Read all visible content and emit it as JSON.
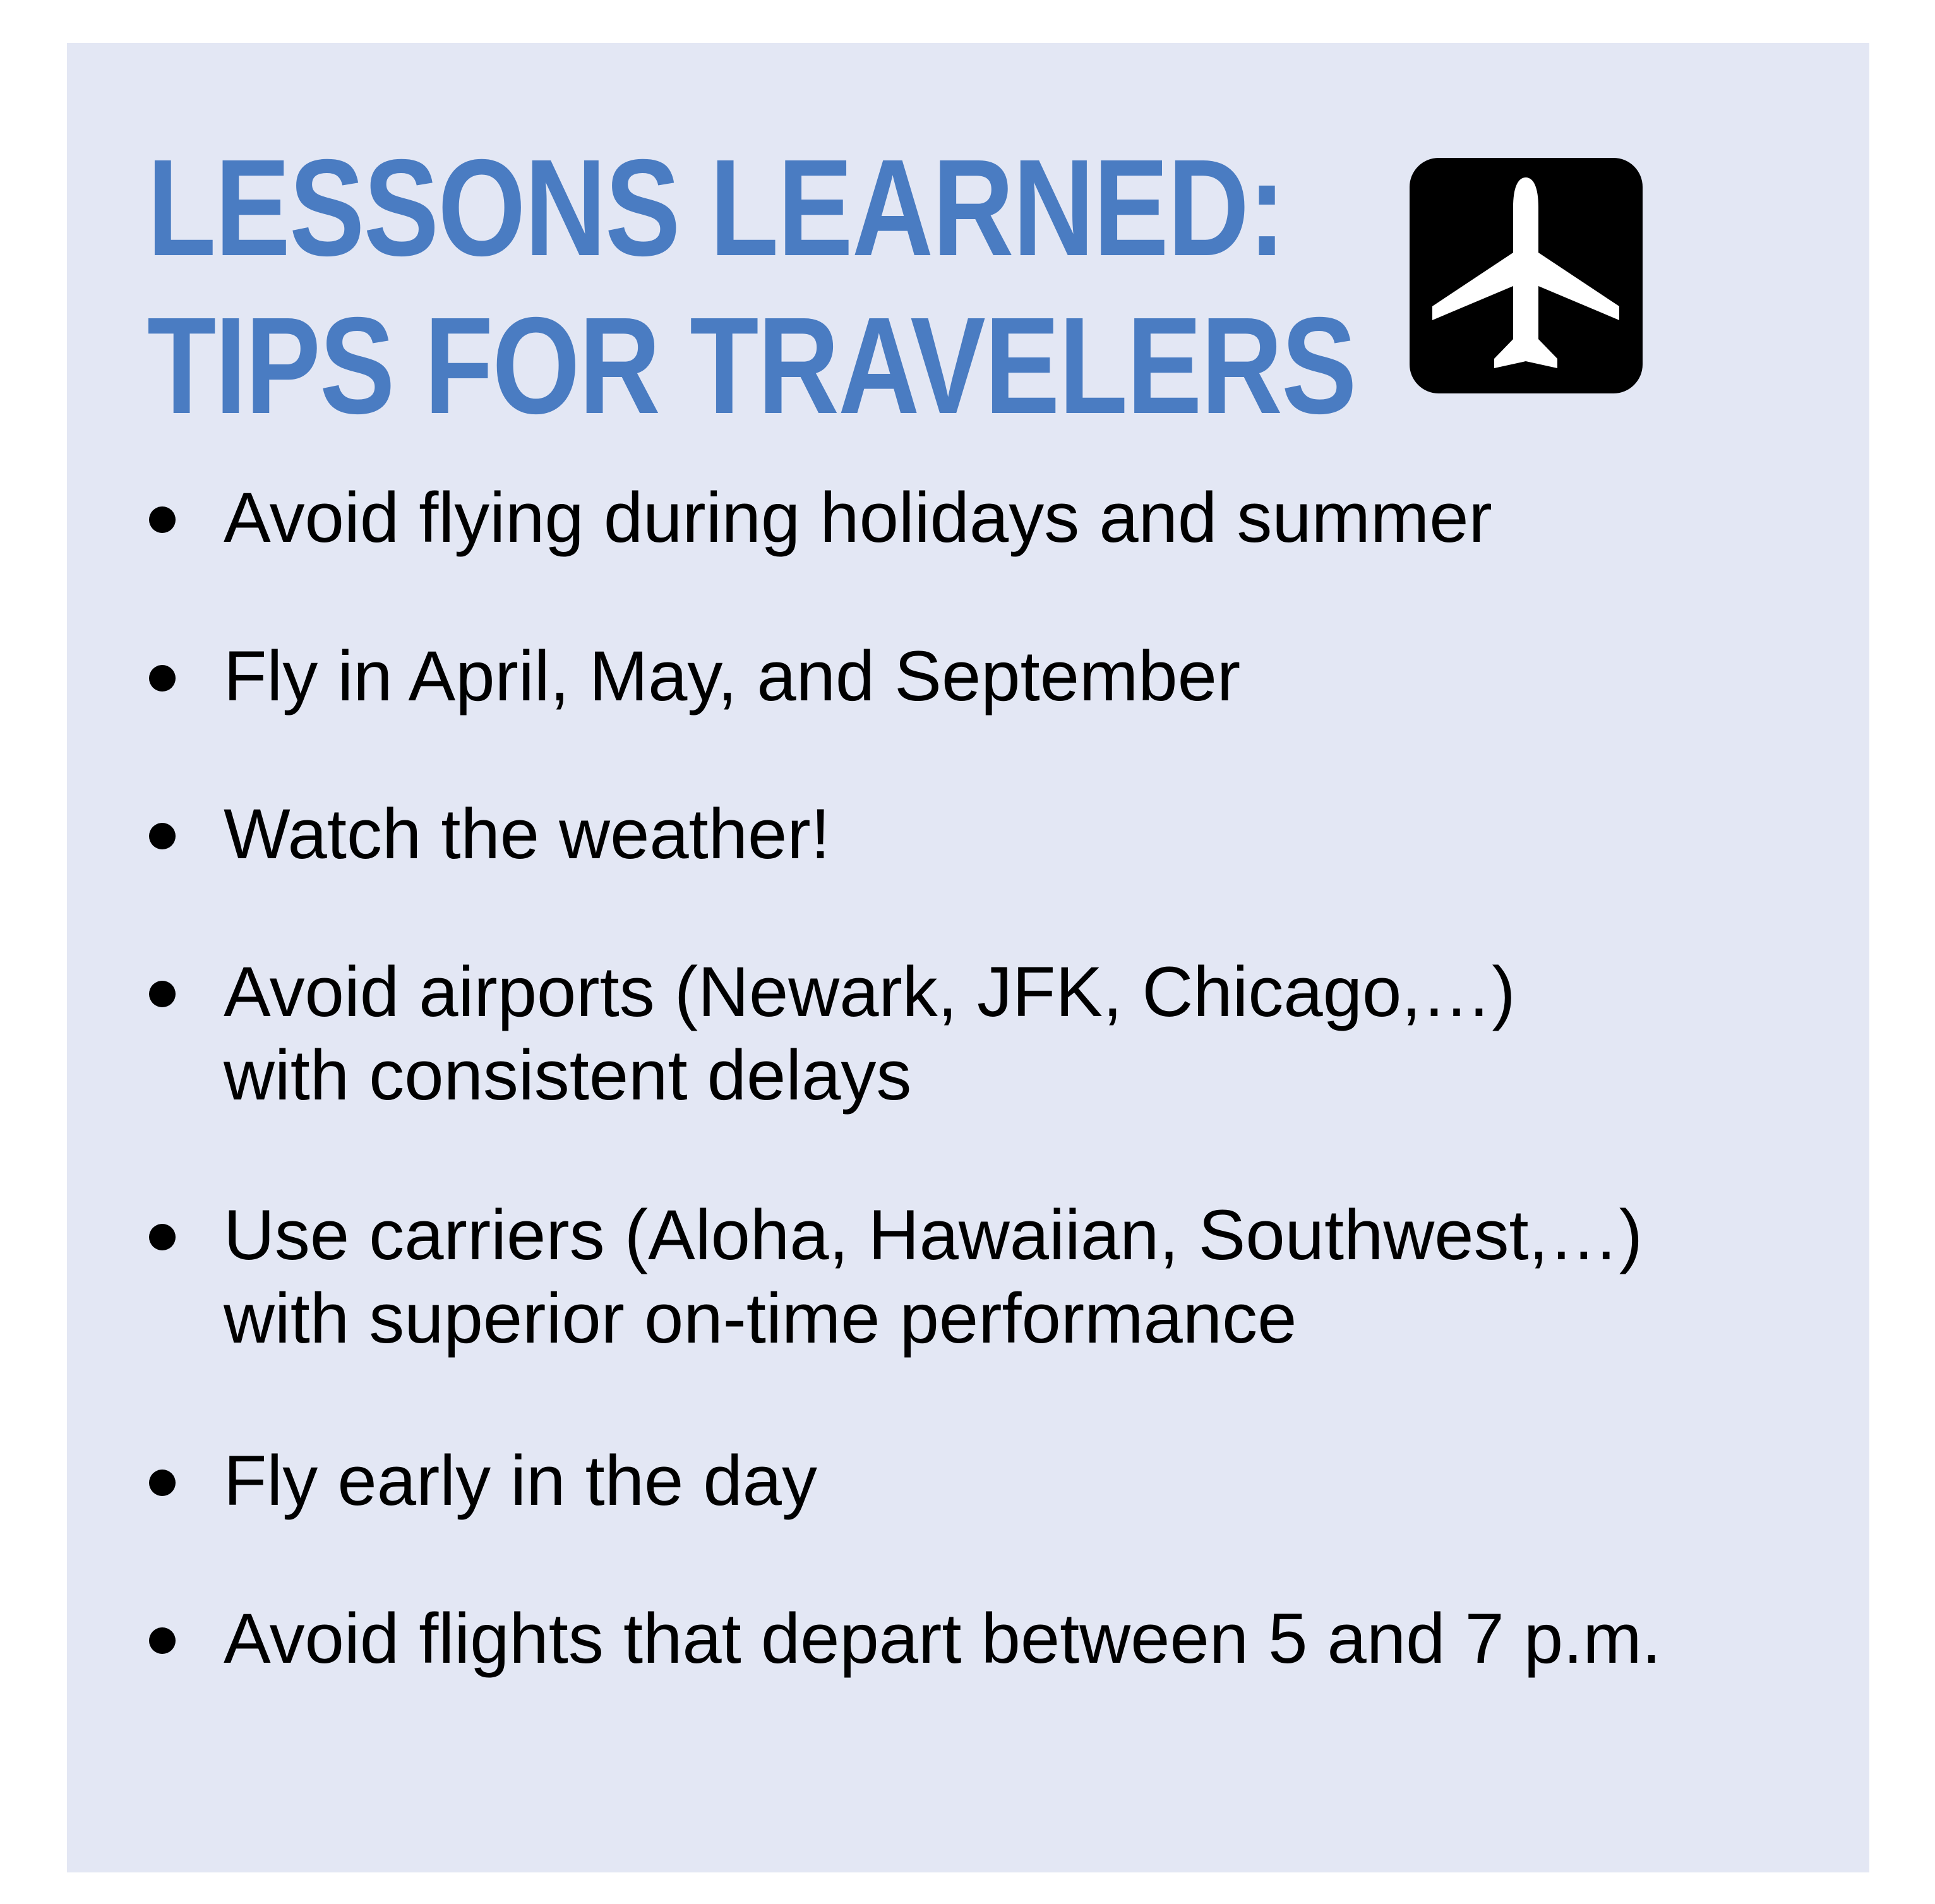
{
  "title": {
    "line1": "LESSONS LEARNED:",
    "line2": "TIPS FOR TRAVELERS"
  },
  "icon": "airplane-icon",
  "colors": {
    "panel_background": "#e3e7f4",
    "title": "#4a7cc2",
    "icon_badge": "#000000",
    "text": "#000000"
  },
  "tips": [
    {
      "line1": "Avoid flying during holidays and summer",
      "line2": ""
    },
    {
      "line1": "Fly in April, May, and September",
      "line2": ""
    },
    {
      "line1": "Watch the weather!",
      "line2": ""
    },
    {
      "line1": "Avoid airports (Newark, JFK, Chicago,…)",
      "line2": "with consistent delays"
    },
    {
      "line1": "Use carriers (Aloha, Hawaiian, Southwest,…)",
      "line2": "with superior on-time performance"
    },
    {
      "line1": "Fly early in the day",
      "line2": ""
    },
    {
      "line1": "Avoid flights that depart between 5 and 7 p.m.",
      "line2": ""
    }
  ]
}
